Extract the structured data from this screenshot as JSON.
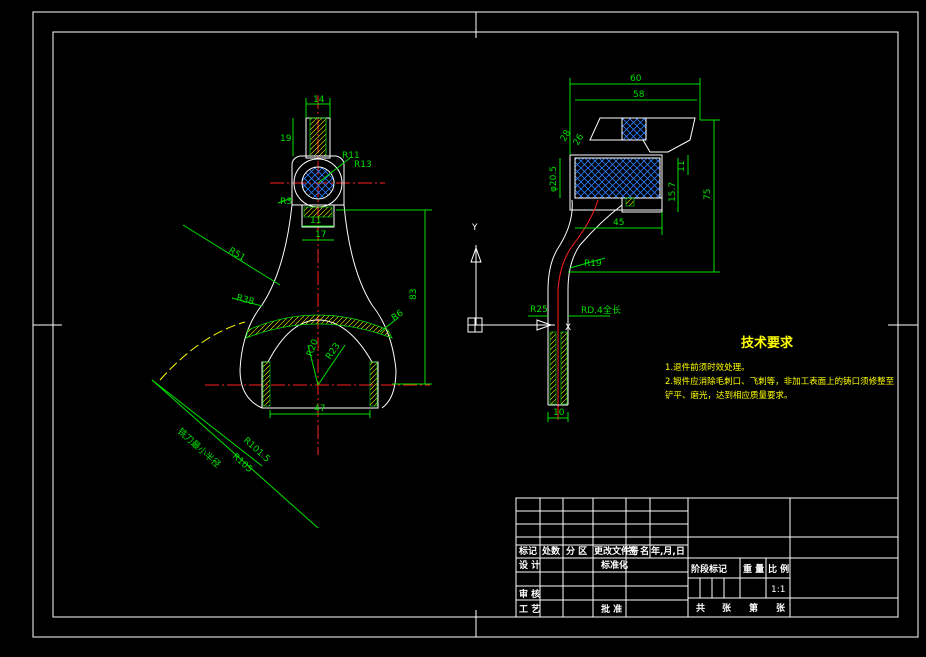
{
  "front_view": {
    "dims": {
      "d14": "14",
      "d19": "19",
      "r11": "R11",
      "r13": "R13",
      "r3": "R3",
      "d11": "11",
      "d17": "17",
      "r51": "R51",
      "r38": "R38",
      "d83": "83",
      "r6": "R6",
      "r20": "R20",
      "r23": "R23",
      "d47": "47",
      "r101_5": "R101.5",
      "r105": "R105"
    },
    "note_cutter": "铣刀最小半径"
  },
  "side_view": {
    "dims": {
      "d60": "60",
      "d58": "58",
      "d28": "28",
      "d26": "26",
      "phi20_5": "φ20.5",
      "d15_7": "15.7",
      "d11": "11",
      "d75": "75",
      "d45": "45",
      "r19": "R19",
      "r25": "R25",
      "rd4": "RD.4",
      "full": "全长",
      "d10": "10"
    }
  },
  "axis": {
    "y_label": "Y",
    "x_label": "X"
  },
  "tech_req": {
    "title": "技术要求",
    "items": [
      "1.退件前须时效处理。",
      "2.锻件应消除毛刺口、飞刺等，非加工表面上的铸口须修整至",
      "铲平、磨光，达到相应质量要求。"
    ]
  },
  "title_block": {
    "row_headers": [
      "标记",
      "处数",
      "分 区",
      "更改文件号",
      "签 名",
      "年,月,日"
    ],
    "design": "设 计",
    "standardize": "标准化",
    "review": "审 核",
    "process": "工 艺",
    "approve": "批 准",
    "stage_mark": "阶段标记",
    "weight": "重 量",
    "scale": "比 例",
    "scale_value": "1:1",
    "sheet_total": "共",
    "sheet_label": "张",
    "sheet_no": "第",
    "sheet_label2": "张"
  }
}
